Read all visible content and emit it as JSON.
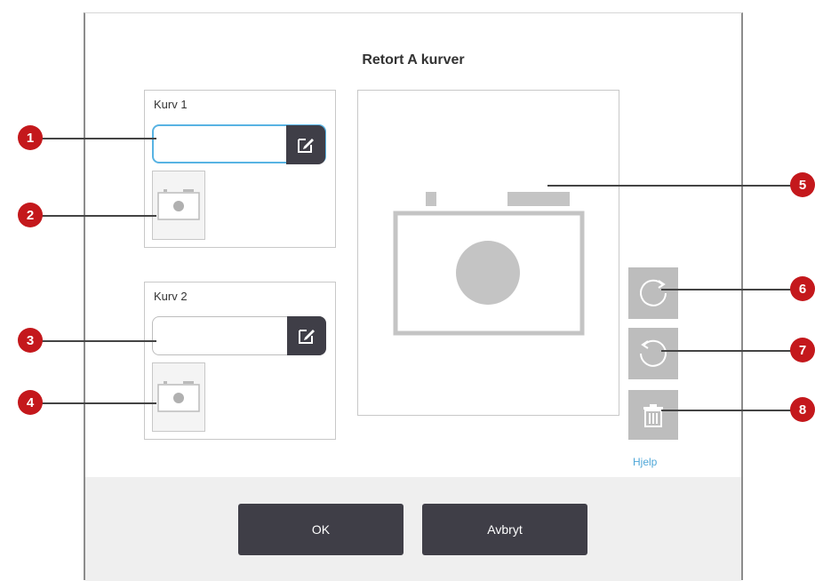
{
  "dialog": {
    "title": "Retort A kurver",
    "help_label": "Hjelp"
  },
  "baskets": [
    {
      "label": "Kurv 1",
      "input_value": "",
      "active": true
    },
    {
      "label": "Kurv 2",
      "input_value": "",
      "active": false
    }
  ],
  "footer": {
    "ok_label": "OK",
    "cancel_label": "Avbryt"
  },
  "callouts": [
    "1",
    "2",
    "3",
    "4",
    "5",
    "6",
    "7",
    "8"
  ],
  "icons": {
    "edit": "pencil-edit-icon",
    "camera": "camera-icon",
    "rotate_cw": "rotate-clockwise-icon",
    "rotate_ccw": "rotate-counterclockwise-icon",
    "delete": "trash-icon"
  },
  "colors": {
    "accent": "#58b3e3",
    "dark_button": "#3f3e47",
    "callout": "#c4181c",
    "disabled_button": "#bdbdbd"
  }
}
